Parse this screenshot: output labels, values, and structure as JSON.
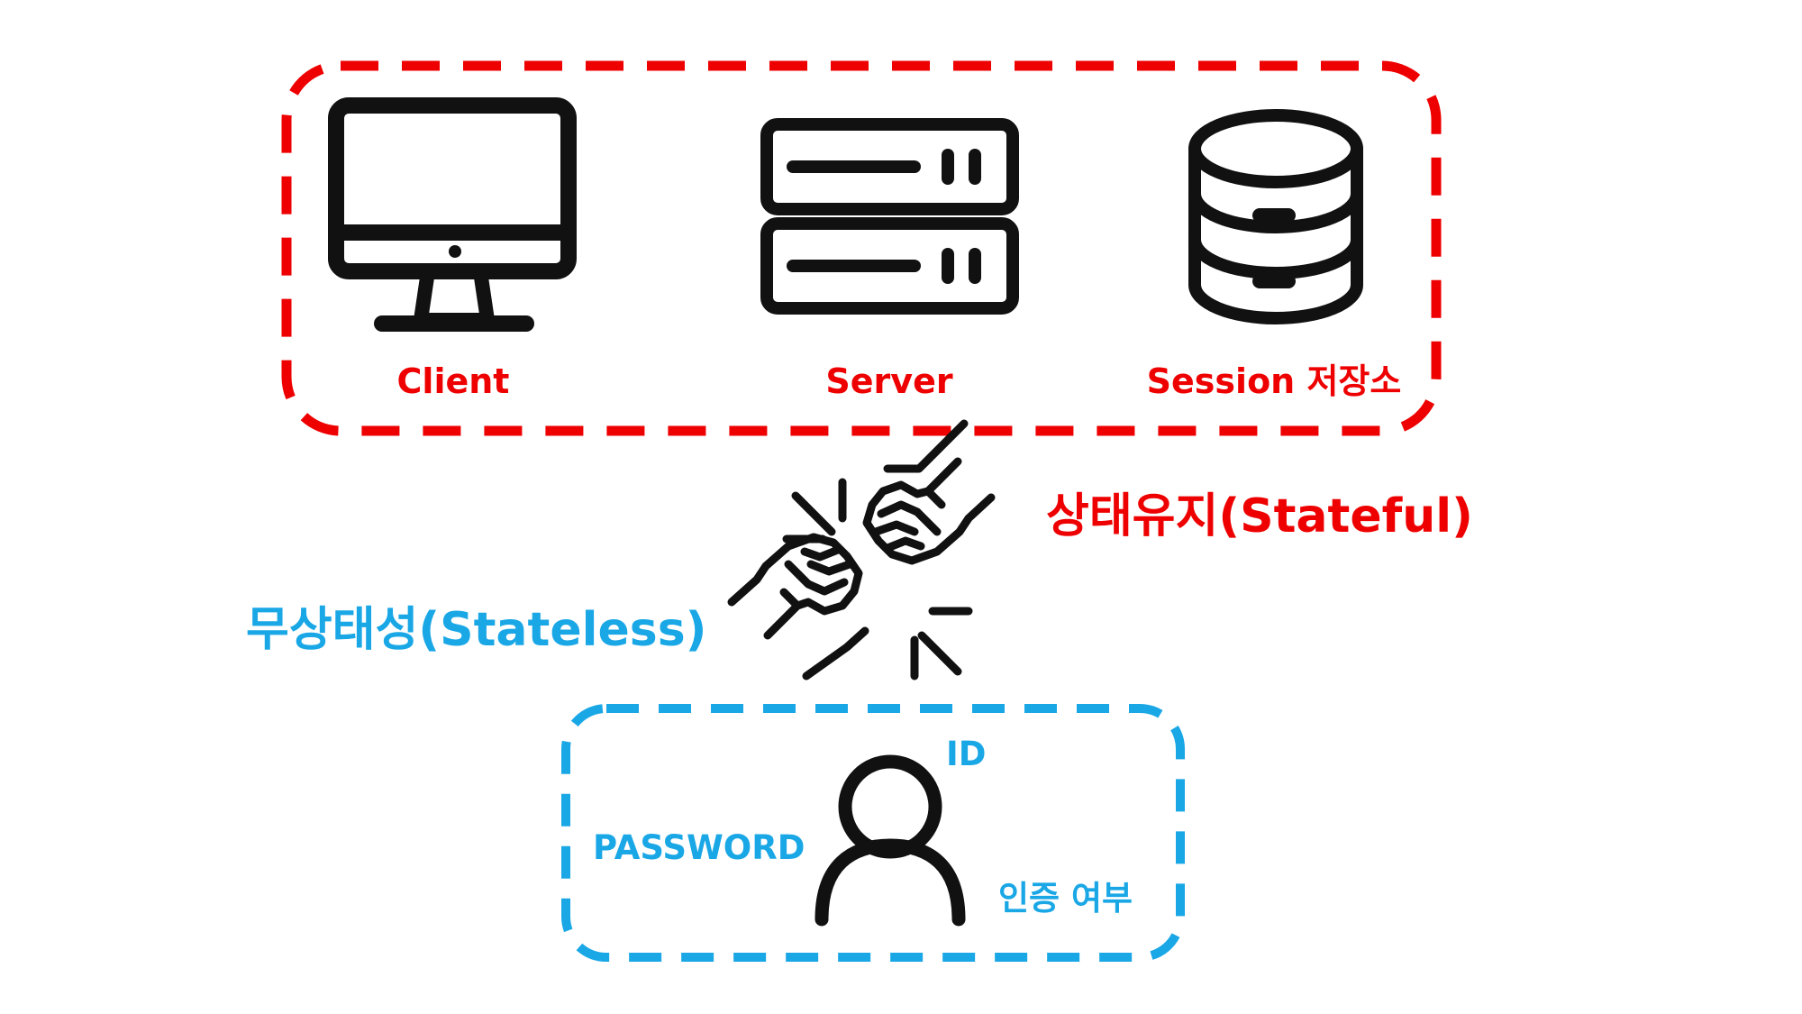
{
  "stateful_group": {
    "client_label": "Client",
    "server_label": "Server",
    "session_label": "Session 저장소",
    "icons": [
      "monitor-icon",
      "server-rack-icon",
      "database-icon"
    ]
  },
  "middle": {
    "stateful_label": "상태유지(Stateful)",
    "stateless_label": "무상태성(Stateless)",
    "icon": "fist-bump-icon"
  },
  "stateless_group": {
    "id_label": "ID",
    "password_label": "PASSWORD",
    "auth_label": "인증 여부",
    "icon": "user-icon"
  },
  "colors": {
    "stateful": "#ee0000",
    "stateless": "#1aa7e6",
    "icon": "#111111"
  }
}
